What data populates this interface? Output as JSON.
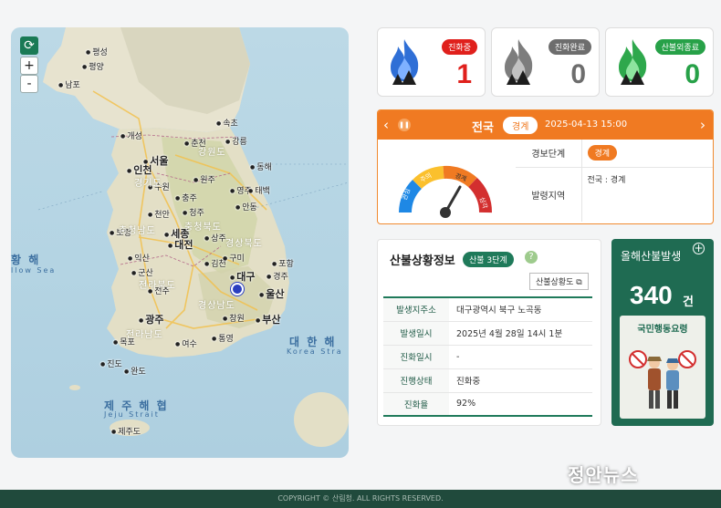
{
  "map": {
    "refresh_label": "⟳",
    "zoom_in_label": "+",
    "zoom_out_label": "-",
    "cities": [
      "평성",
      "평양",
      "남포",
      "개성",
      "서울",
      "인천",
      "춘천",
      "강릉",
      "원주",
      "수원",
      "청주",
      "동해",
      "세종",
      "대전",
      "전주",
      "군산",
      "대구",
      "포항",
      "울산",
      "광주",
      "부산",
      "목포",
      "여수",
      "진도",
      "완도",
      "제주도",
      "천안",
      "상주",
      "안동",
      "영주",
      "충주",
      "속초",
      "김천",
      "구미",
      "창원",
      "통영",
      "경주",
      "태백",
      "보령",
      "익산"
    ],
    "provinces": [
      "경기도",
      "강원도",
      "충청북도",
      "충청남도",
      "경상북도",
      "전라북도",
      "전라남도",
      "경상남도"
    ],
    "seas": {
      "west": "황 해",
      "west_en": "llow Sea",
      "east": "대 한 해",
      "east_en": "Korea Stra",
      "south": "제 주 해 협",
      "south_en": "Jeju Strait"
    }
  },
  "status": {
    "active": {
      "label": "진화중",
      "count": "1",
      "color": "#e0201c"
    },
    "contained": {
      "label": "진화완료",
      "count": "0",
      "color": "#6d6d6d"
    },
    "other": {
      "label": "산불외종료",
      "count": "0",
      "color": "#27a148"
    }
  },
  "alert": {
    "prev_icon": "‹",
    "next_icon": "›",
    "pause_icon": "❚❚",
    "region": "전국",
    "level": "경계",
    "datetime": "2025-04-13 15:00",
    "rows": [
      {
        "key": "경보단계",
        "value": "경계"
      },
      {
        "key": "발령지역",
        "value": "전국 : 경계"
      }
    ],
    "gauge": {
      "labels": [
        "관심",
        "주의",
        "경계",
        "심각"
      ],
      "level_index": 2
    }
  },
  "fire_info": {
    "title": "산불상황정보",
    "stage": "산불 3단계",
    "help_icon": "?",
    "detail_button": "산불상황도 ⧉",
    "rows": [
      {
        "key": "발생지주소",
        "value": "대구광역시 북구 노곡동"
      },
      {
        "key": "발생일시",
        "value": "2025년 4월 28일 14시 1분"
      },
      {
        "key": "진화일시",
        "value": "-"
      },
      {
        "key": "진행상태",
        "value": "진화중"
      },
      {
        "key": "진화율",
        "value": "92%"
      }
    ]
  },
  "year": {
    "title": "올해산불발생",
    "plus_icon": "+",
    "count": "340",
    "unit": "건",
    "campaign_title": "국민행동요령"
  },
  "footer": {
    "copyright": "COPYRIGHT © 산림청. ALL RIGHTS RESERVED."
  },
  "watermark": "정안뉴스"
}
